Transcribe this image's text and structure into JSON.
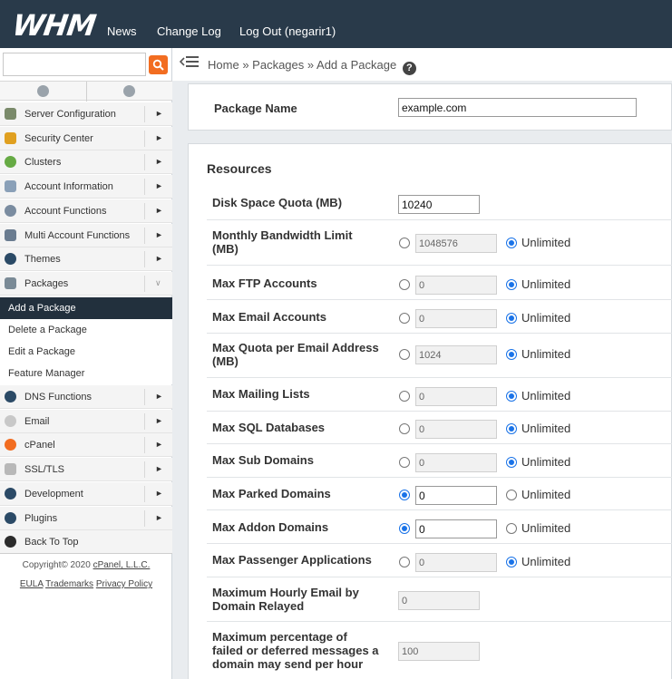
{
  "header": {
    "logo": "WHM",
    "nav": [
      "News",
      "Change Log",
      "Log Out (negarir1)"
    ]
  },
  "search": {
    "placeholder": ""
  },
  "sidebar": {
    "items": [
      {
        "label": "Server Configuration",
        "icon": "server-icon",
        "color": "#7a8a6a"
      },
      {
        "label": "Security Center",
        "icon": "lock-icon",
        "color": "#e0a020"
      },
      {
        "label": "Clusters",
        "icon": "clusters-icon",
        "color": "#66aa44"
      },
      {
        "label": "Account Information",
        "icon": "account-info-icon",
        "color": "#8aa0b8"
      },
      {
        "label": "Account Functions",
        "icon": "user-icon",
        "color": "#7a8ca0"
      },
      {
        "label": "Multi Account Functions",
        "icon": "users-icon",
        "color": "#6a7c90"
      },
      {
        "label": "Themes",
        "icon": "palette-icon",
        "color": "#2b4a66"
      },
      {
        "label": "Packages",
        "icon": "package-icon",
        "color": "#7a8a96"
      }
    ],
    "sub_items": [
      "Add a Package",
      "Delete a Package",
      "Edit a Package",
      "Feature Manager"
    ],
    "items2": [
      {
        "label": "DNS Functions",
        "icon": "dns-icon",
        "color": "#2b4a66"
      },
      {
        "label": "Email",
        "icon": "email-icon",
        "color": "#c8c8c8"
      },
      {
        "label": "cPanel",
        "icon": "cpanel-icon",
        "color": "#f26d21"
      },
      {
        "label": "SSL/TLS",
        "icon": "certificate-icon",
        "color": "#b8b8b8"
      },
      {
        "label": "Development",
        "icon": "development-icon",
        "color": "#2b4a66"
      },
      {
        "label": "Plugins",
        "icon": "plugin-icon",
        "color": "#2b4a66"
      },
      {
        "label": "Back To Top",
        "icon": "arrow-up-icon",
        "color": "#2b2b2b"
      }
    ],
    "copyright": "Copyright© 2020",
    "company": "cPanel, L.L.C.",
    "links": [
      "EULA",
      "Trademarks",
      "Privacy Policy"
    ]
  },
  "breadcrumb": {
    "home": "Home",
    "sep": "»",
    "packages": "Packages",
    "current": "Add a Package",
    "help": "?"
  },
  "form": {
    "package_name_label": "Package Name",
    "package_name_value": "example.com",
    "resources_title": "Resources",
    "unlimited_label": "Unlimited",
    "disk_label": "Disk Space Quota (MB)",
    "disk_value": "10240",
    "rows": [
      {
        "label1": "Monthly Bandwidth Limit",
        "label2": "(MB)",
        "value": "1048576",
        "unlimited": true
      },
      {
        "label1": "Max FTP Accounts",
        "label2": "",
        "value": "0",
        "unlimited": true
      },
      {
        "label1": "Max Email Accounts",
        "label2": "",
        "value": "0",
        "unlimited": true
      },
      {
        "label1": "Max Quota per Email Address",
        "label2": "(MB)",
        "value": "1024",
        "unlimited": true
      },
      {
        "label1": "Max Mailing Lists",
        "label2": "",
        "value": "0",
        "unlimited": true
      },
      {
        "label1": "Max SQL Databases",
        "label2": "",
        "value": "0",
        "unlimited": true
      },
      {
        "label1": "Max Sub Domains",
        "label2": "",
        "value": "0",
        "unlimited": true
      },
      {
        "label1": "Max Parked Domains",
        "label2": "",
        "value": "0",
        "unlimited": false
      },
      {
        "label1": "Max Addon Domains",
        "label2": "",
        "value": "0",
        "unlimited": false
      },
      {
        "label1": "Max Passenger Applications",
        "label2": "",
        "value": "0",
        "unlimited": true
      }
    ],
    "hourly_label1": "Maximum Hourly Email by",
    "hourly_label2": "Domain Relayed",
    "hourly_value": "0",
    "pct_label1": "Maximum percentage of",
    "pct_label2": "failed or deferred messages a",
    "pct_label3": "domain may send per hour",
    "pct_value": "100"
  }
}
